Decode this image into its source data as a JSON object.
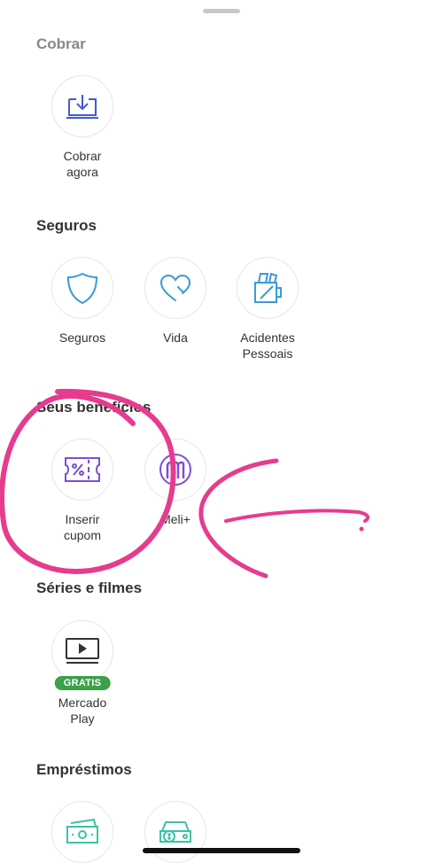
{
  "sections": {
    "cobrar": {
      "title": "Cobrar",
      "items": [
        {
          "label": "Cobrar\nagora",
          "icon": "download-tray-icon"
        }
      ]
    },
    "seguros": {
      "title": "Seguros",
      "items": [
        {
          "label": "Seguros",
          "icon": "shield-icon"
        },
        {
          "label": "Vida",
          "icon": "heart-icon"
        },
        {
          "label": "Acidentes\nPessoais",
          "icon": "bandage-icon"
        }
      ]
    },
    "beneficios": {
      "title": "Seus benefícios",
      "items": [
        {
          "label": "Inserir\ncupom",
          "icon": "coupon-icon"
        },
        {
          "label": "Meli+",
          "icon": "meli-plus-icon"
        }
      ]
    },
    "series": {
      "title": "Séries e filmes",
      "items": [
        {
          "label": "Mercado\nPlay",
          "icon": "play-screen-icon",
          "badge": "GRATIS"
        }
      ]
    },
    "emprestimos": {
      "title": "Empréstimos",
      "items": [
        {
          "label": "",
          "icon": "money-bill-icon"
        },
        {
          "label": "",
          "icon": "car-loan-icon"
        }
      ]
    }
  },
  "colors": {
    "icon_blue": "#3f5bd6",
    "icon_sky": "#3a9ad9",
    "icon_purple": "#7a4fd6",
    "icon_teal": "#3cc2a8",
    "badge_green": "#3ca14a",
    "annotation_pink": "#e63b8f"
  }
}
